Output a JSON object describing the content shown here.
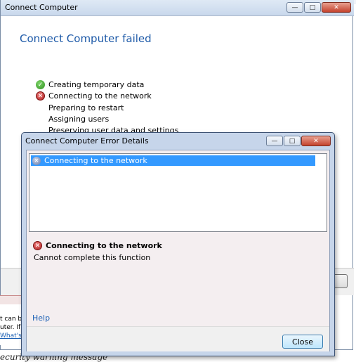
{
  "main_window": {
    "title": "Connect Computer",
    "heading": "Connect Computer failed",
    "steps": [
      {
        "label": "Creating temporary data",
        "status": "success"
      },
      {
        "label": "Connecting to the network",
        "status": "error"
      },
      {
        "label": "Preparing to restart",
        "status": "pending"
      },
      {
        "label": "Assigning users",
        "status": "pending"
      },
      {
        "label": "Preserving user data and settings",
        "status": "pending"
      }
    ]
  },
  "error_dialog": {
    "title": "Connect Computer Error Details",
    "list_items": [
      {
        "label": "Connecting to the network",
        "selected": true
      }
    ],
    "detail_title": "Connecting to the network",
    "detail_message": "Cannot complete this function",
    "help_link": "Help",
    "close_label": "Close"
  },
  "background_page": {
    "side_lines": [
      "t can be",
      "uter. If y",
      "What's th"
    ],
    "bottom_caption": "ecurity warning message"
  },
  "icons": {
    "minimize": "minimize-icon",
    "maximize": "maximize-icon",
    "close": "close-icon",
    "success": "check-icon",
    "error": "error-x-icon"
  },
  "colors": {
    "heading": "#1e5aa8",
    "selection": "#3399ff",
    "link": "#1a5fb4",
    "dialog_frame": "#c6d5ea"
  }
}
